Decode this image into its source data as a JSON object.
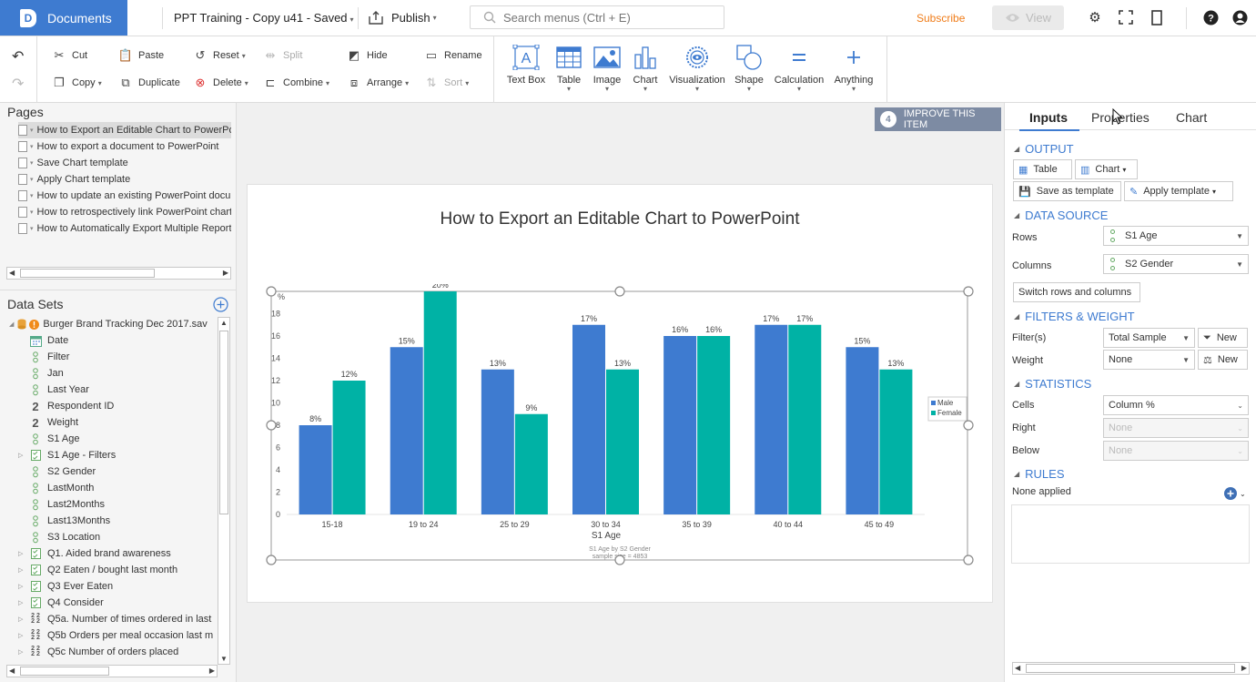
{
  "topbar": {
    "documents_label": "Documents",
    "doc_title": "PPT Training - Copy u41 - Saved",
    "publish_label": "Publish",
    "search_placeholder": "Search menus (Ctrl + E)",
    "subscribe_label": "Subscribe",
    "view_label": "View"
  },
  "ribbon": {
    "cut": "Cut",
    "copy": "Copy",
    "paste": "Paste",
    "duplicate": "Duplicate",
    "reset": "Reset",
    "delete": "Delete",
    "split": "Split",
    "combine": "Combine",
    "hide": "Hide",
    "arrange": "Arrange",
    "rename": "Rename",
    "sort": "Sort",
    "textbox": "Text Box",
    "table": "Table",
    "image": "Image",
    "chart": "Chart",
    "visualization": "Visualization",
    "shape": "Shape",
    "calculation": "Calculation",
    "anything": "Anything"
  },
  "pages": {
    "title": "Pages",
    "items": [
      "How to Export an Editable Chart to PowerPoint",
      "How to export a document to PowerPoint",
      "Save Chart template",
      "Apply Chart template",
      "How to update an existing PowerPoint document",
      "How to retrospectively link PowerPoint charts",
      "How to Automatically Export Multiple Reports"
    ]
  },
  "datasets": {
    "title": "Data Sets",
    "file": "Burger Brand Tracking Dec 2017.sav",
    "items": [
      {
        "label": "Date",
        "icon": "date",
        "exp": false
      },
      {
        "label": "Filter",
        "icon": "cat",
        "exp": false
      },
      {
        "label": "Jan",
        "icon": "cat",
        "exp": false
      },
      {
        "label": "Last Year",
        "icon": "cat",
        "exp": false
      },
      {
        "label": "Respondent ID",
        "icon": "num",
        "exp": false
      },
      {
        "label": "Weight",
        "icon": "num",
        "exp": false
      },
      {
        "label": "S1 Age",
        "icon": "cat",
        "exp": false
      },
      {
        "label": "S1 Age - Filters",
        "icon": "multi",
        "exp": true
      },
      {
        "label": "S2 Gender",
        "icon": "cat",
        "exp": false
      },
      {
        "label": "LastMonth",
        "icon": "cat",
        "exp": false
      },
      {
        "label": "Last2Months",
        "icon": "cat",
        "exp": false
      },
      {
        "label": "Last13Months",
        "icon": "cat",
        "exp": false
      },
      {
        "label": "S3 Location",
        "icon": "cat",
        "exp": false
      },
      {
        "label": "Q1. Aided brand awareness",
        "icon": "multi",
        "exp": true
      },
      {
        "label": "Q2 Eaten / bought last month",
        "icon": "multi",
        "exp": true
      },
      {
        "label": "Q3 Ever Eaten",
        "icon": "multi",
        "exp": true
      },
      {
        "label": "Q4 Consider",
        "icon": "multi",
        "exp": true
      },
      {
        "label": "Q5a. Number of times ordered in last",
        "icon": "numgrid",
        "exp": true
      },
      {
        "label": "Q5b Orders per meal occasion last m",
        "icon": "numgrid",
        "exp": true
      },
      {
        "label": "Q5c Number of orders placed",
        "icon": "numgrid",
        "exp": true
      }
    ]
  },
  "canvas": {
    "improve_label": "IMPROVE THIS ITEM",
    "improve_count": "4",
    "page_title": "How to Export an Editable Chart to PowerPoint"
  },
  "chart_data": {
    "type": "bar",
    "categories": [
      "15-18",
      "19 to 24",
      "25 to 29",
      "30 to 34",
      "35 to 39",
      "40 to 44",
      "45 to 49"
    ],
    "series": [
      {
        "name": "Male",
        "values": [
          8,
          15,
          13,
          17,
          16,
          17,
          15
        ],
        "labels": [
          "8%",
          "15%",
          "13%",
          "17%",
          "16%",
          "17%",
          "15%"
        ],
        "color": "#3e7bd0"
      },
      {
        "name": "Female",
        "values": [
          12,
          20,
          9,
          13,
          16,
          17,
          13
        ],
        "labels": [
          "12%",
          "20%",
          "9%",
          "13%",
          "16%",
          "17%",
          "13%"
        ],
        "color": "#00b2a5"
      }
    ],
    "ylabel": "%",
    "xlabel": "S1 Age",
    "yticks": [
      "0",
      "2",
      "4",
      "6",
      "8",
      "10",
      "12",
      "14",
      "16",
      "18"
    ],
    "ylim": [
      0,
      20
    ],
    "footer1": "S1 Age by S2 Gender",
    "footer2": "sample size = 4853",
    "legend_position": "right"
  },
  "right_panel": {
    "tabs": [
      "Inputs",
      "Properties",
      "Chart"
    ],
    "output": "OUTPUT",
    "table_btn": "Table",
    "chart_btn": "Chart",
    "save_template": "Save as template",
    "apply_template": "Apply template",
    "data_source": "DATA SOURCE",
    "rows_label": "Rows",
    "rows_value": "S1 Age",
    "columns_label": "Columns",
    "columns_value": "S2 Gender",
    "switch_btn": "Switch rows and columns",
    "filters_weight": "FILTERS & WEIGHT",
    "filters_label": "Filter(s)",
    "filters_value": "Total Sample",
    "new_label": "New",
    "weight_label": "Weight",
    "weight_value": "None",
    "statistics": "STATISTICS",
    "cells_label": "Cells",
    "cells_value": "Column %",
    "right_label": "Right",
    "right_value": "None",
    "below_label": "Below",
    "below_value": "None",
    "rules": "RULES",
    "rules_value": "None applied"
  }
}
